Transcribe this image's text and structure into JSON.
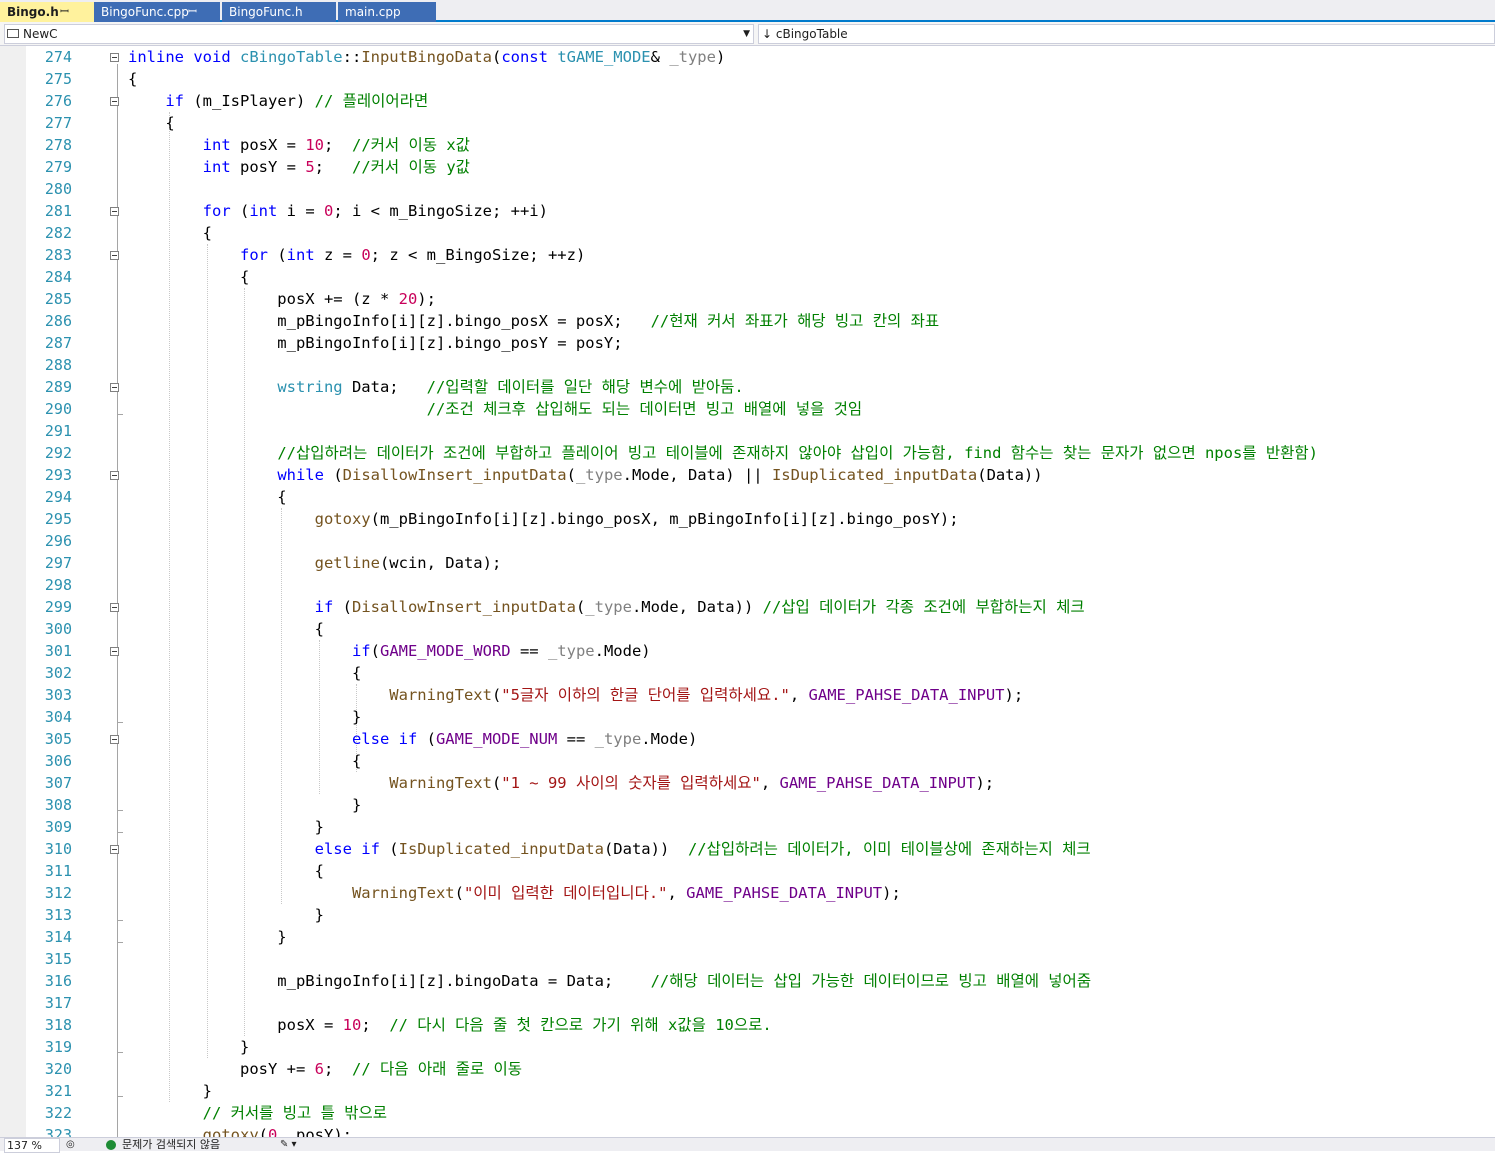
{
  "tabs": [
    {
      "label": "Bingo.h",
      "active": true,
      "pinned": true
    },
    {
      "label": "BingoFunc.cpp",
      "active": false,
      "pinned": true
    },
    {
      "label": "BingoFunc.h",
      "active": false,
      "pinned": false
    },
    {
      "label": "main.cpp",
      "active": false,
      "pinned": false
    }
  ],
  "nav": {
    "scope": "NewC",
    "member": "cBingoTable"
  },
  "status": {
    "zoom": "137 %",
    "issues": "문제가 검색되지 않음"
  },
  "lines": [
    {
      "n": "274",
      "segs": [
        [
          "kw",
          "inline void "
        ],
        [
          "ty",
          "cBingoTable"
        ],
        [
          "",
          "::"
        ],
        [
          "fn",
          "InputBingoData"
        ],
        [
          "",
          "("
        ],
        [
          "kw",
          "const "
        ],
        [
          "ty",
          "tGAME_MODE"
        ],
        [
          "",
          "& "
        ],
        [
          "pa",
          "_type"
        ],
        [
          "",
          ")"
        ]
      ]
    },
    {
      "n": "275",
      "segs": [
        [
          "",
          "{"
        ]
      ]
    },
    {
      "n": "276",
      "segs": [
        [
          "",
          "    "
        ],
        [
          "kw",
          "if"
        ],
        [
          "",
          " (m_IsPlayer) "
        ],
        [
          "cm",
          "// 플레이어라면"
        ]
      ]
    },
    {
      "n": "277",
      "segs": [
        [
          "",
          "    {"
        ]
      ]
    },
    {
      "n": "278",
      "segs": [
        [
          "",
          "        "
        ],
        [
          "kw",
          "int"
        ],
        [
          "",
          " posX = "
        ],
        [
          "num",
          "10"
        ],
        [
          "",
          ";  "
        ],
        [
          "cm",
          "//커서 이동 x값"
        ]
      ]
    },
    {
      "n": "279",
      "segs": [
        [
          "",
          "        "
        ],
        [
          "kw",
          "int"
        ],
        [
          "",
          " posY = "
        ],
        [
          "num",
          "5"
        ],
        [
          "",
          ";   "
        ],
        [
          "cm",
          "//커서 이동 y값"
        ]
      ]
    },
    {
      "n": "280",
      "segs": [
        [
          "",
          ""
        ]
      ]
    },
    {
      "n": "281",
      "segs": [
        [
          "",
          "        "
        ],
        [
          "kw",
          "for"
        ],
        [
          "",
          " ("
        ],
        [
          "kw",
          "int"
        ],
        [
          "",
          " i = "
        ],
        [
          "num",
          "0"
        ],
        [
          "",
          "; i < m_BingoSize; ++i)"
        ]
      ]
    },
    {
      "n": "282",
      "segs": [
        [
          "",
          "        {"
        ]
      ]
    },
    {
      "n": "283",
      "segs": [
        [
          "",
          "            "
        ],
        [
          "kw",
          "for"
        ],
        [
          "",
          " ("
        ],
        [
          "kw",
          "int"
        ],
        [
          "",
          " z = "
        ],
        [
          "num",
          "0"
        ],
        [
          "",
          "; z < m_BingoSize; ++z)"
        ]
      ]
    },
    {
      "n": "284",
      "segs": [
        [
          "",
          "            {"
        ]
      ]
    },
    {
      "n": "285",
      "segs": [
        [
          "",
          "                posX += (z * "
        ],
        [
          "num",
          "20"
        ],
        [
          "",
          ");"
        ]
      ]
    },
    {
      "n": "286",
      "segs": [
        [
          "",
          "                m_pBingoInfo[i][z].bingo_posX = posX;   "
        ],
        [
          "cm",
          "//현재 커서 좌표가 해당 빙고 칸의 좌표"
        ]
      ]
    },
    {
      "n": "287",
      "segs": [
        [
          "",
          "                m_pBingoInfo[i][z].bingo_posY = posY;"
        ]
      ]
    },
    {
      "n": "288",
      "segs": [
        [
          "",
          ""
        ]
      ]
    },
    {
      "n": "289",
      "segs": [
        [
          "",
          "                "
        ],
        [
          "ty",
          "wstring"
        ],
        [
          "",
          " Data;   "
        ],
        [
          "cm",
          "//입력할 데이터를 일단 해당 변수에 받아둠."
        ]
      ]
    },
    {
      "n": "290",
      "segs": [
        [
          "",
          "                                "
        ],
        [
          "cm",
          "//조건 체크후 삽입해도 되는 데이터면 빙고 배열에 넣을 것임"
        ]
      ]
    },
    {
      "n": "291",
      "segs": [
        [
          "",
          ""
        ]
      ]
    },
    {
      "n": "292",
      "segs": [
        [
          "",
          "                "
        ],
        [
          "cm",
          "//삽입하려는 데이터가 조건에 부합하고 플레이어 빙고 테이블에 존재하지 않아야 삽입이 가능함, find 함수는 찾는 문자가 없으면 npos를 반환함)"
        ]
      ]
    },
    {
      "n": "293",
      "segs": [
        [
          "",
          "                "
        ],
        [
          "kw",
          "while"
        ],
        [
          "",
          " ("
        ],
        [
          "fn",
          "DisallowInsert_inputData"
        ],
        [
          "",
          "("
        ],
        [
          "pa",
          "_type"
        ],
        [
          "",
          ".Mode, Data) || "
        ],
        [
          "fn",
          "IsDuplicated_inputData"
        ],
        [
          "",
          "(Data))"
        ]
      ]
    },
    {
      "n": "294",
      "segs": [
        [
          "",
          "                {"
        ]
      ]
    },
    {
      "n": "295",
      "segs": [
        [
          "",
          "                    "
        ],
        [
          "fn",
          "gotoxy"
        ],
        [
          "",
          "(m_pBingoInfo[i][z].bingo_posX, m_pBingoInfo[i][z].bingo_posY);"
        ]
      ]
    },
    {
      "n": "296",
      "segs": [
        [
          "",
          ""
        ]
      ]
    },
    {
      "n": "297",
      "segs": [
        [
          "",
          "                    "
        ],
        [
          "fn",
          "getline"
        ],
        [
          "",
          "(wcin, Data);"
        ]
      ]
    },
    {
      "n": "298",
      "segs": [
        [
          "",
          ""
        ]
      ]
    },
    {
      "n": "299",
      "segs": [
        [
          "",
          "                    "
        ],
        [
          "kw",
          "if"
        ],
        [
          "",
          " ("
        ],
        [
          "fn",
          "DisallowInsert_inputData"
        ],
        [
          "",
          "("
        ],
        [
          "pa",
          "_type"
        ],
        [
          "",
          ".Mode, Data)) "
        ],
        [
          "cm",
          "//삽입 데이터가 각종 조건에 부합하는지 체크"
        ]
      ]
    },
    {
      "n": "300",
      "segs": [
        [
          "",
          "                    {"
        ]
      ]
    },
    {
      "n": "301",
      "segs": [
        [
          "",
          "                        "
        ],
        [
          "kw",
          "if"
        ],
        [
          "",
          "("
        ],
        [
          "mc",
          "GAME_MODE_WORD"
        ],
        [
          "",
          " == "
        ],
        [
          "pa",
          "_type"
        ],
        [
          "",
          ".Mode)"
        ]
      ]
    },
    {
      "n": "302",
      "segs": [
        [
          "",
          "                        {"
        ]
      ]
    },
    {
      "n": "303",
      "segs": [
        [
          "",
          "                            "
        ],
        [
          "fn",
          "WarningText"
        ],
        [
          "",
          "("
        ],
        [
          "st",
          "\"5글자 이하의 한글 단어를 입력하세요.\""
        ],
        [
          "",
          ", "
        ],
        [
          "mc",
          "GAME_PAHSE_DATA_INPUT"
        ],
        [
          "",
          ");"
        ]
      ]
    },
    {
      "n": "304",
      "segs": [
        [
          "",
          "                        }"
        ]
      ]
    },
    {
      "n": "305",
      "segs": [
        [
          "",
          "                        "
        ],
        [
          "kw",
          "else if"
        ],
        [
          "",
          " ("
        ],
        [
          "mc",
          "GAME_MODE_NUM"
        ],
        [
          "",
          " == "
        ],
        [
          "pa",
          "_type"
        ],
        [
          "",
          ".Mode)"
        ]
      ]
    },
    {
      "n": "306",
      "segs": [
        [
          "",
          "                        {"
        ]
      ]
    },
    {
      "n": "307",
      "segs": [
        [
          "",
          "                            "
        ],
        [
          "fn",
          "WarningText"
        ],
        [
          "",
          "("
        ],
        [
          "st",
          "\"1 ~ 99 사이의 숫자를 입력하세요\""
        ],
        [
          "",
          ", "
        ],
        [
          "mc",
          "GAME_PAHSE_DATA_INPUT"
        ],
        [
          "",
          ");"
        ]
      ]
    },
    {
      "n": "308",
      "segs": [
        [
          "",
          "                        }"
        ]
      ]
    },
    {
      "n": "309",
      "segs": [
        [
          "",
          "                    }"
        ]
      ]
    },
    {
      "n": "310",
      "segs": [
        [
          "",
          "                    "
        ],
        [
          "kw",
          "else if"
        ],
        [
          "",
          " ("
        ],
        [
          "fn",
          "IsDuplicated_inputData"
        ],
        [
          "",
          "(Data))  "
        ],
        [
          "cm",
          "//삽입하려는 데이터가, 이미 테이블상에 존재하는지 체크"
        ]
      ]
    },
    {
      "n": "311",
      "segs": [
        [
          "",
          "                    {"
        ]
      ]
    },
    {
      "n": "312",
      "segs": [
        [
          "",
          "                        "
        ],
        [
          "fn",
          "WarningText"
        ],
        [
          "",
          "("
        ],
        [
          "st",
          "\"이미 입력한 데이터입니다.\""
        ],
        [
          "",
          ", "
        ],
        [
          "mc",
          "GAME_PAHSE_DATA_INPUT"
        ],
        [
          "",
          ");"
        ]
      ]
    },
    {
      "n": "313",
      "segs": [
        [
          "",
          "                    }"
        ]
      ]
    },
    {
      "n": "314",
      "segs": [
        [
          "",
          "                }"
        ]
      ]
    },
    {
      "n": "315",
      "segs": [
        [
          "",
          ""
        ]
      ]
    },
    {
      "n": "316",
      "segs": [
        [
          "",
          "                m_pBingoInfo[i][z].bingoData = Data;    "
        ],
        [
          "cm",
          "//해당 데이터는 삽입 가능한 데이터이므로 빙고 배열에 넣어줌"
        ]
      ]
    },
    {
      "n": "317",
      "segs": [
        [
          "",
          ""
        ]
      ]
    },
    {
      "n": "318",
      "segs": [
        [
          "",
          "                posX = "
        ],
        [
          "num",
          "10"
        ],
        [
          "",
          ";  "
        ],
        [
          "cm",
          "// 다시 다음 줄 첫 칸으로 가기 위해 x값을 10으로."
        ]
      ]
    },
    {
      "n": "319",
      "segs": [
        [
          "",
          "            }"
        ]
      ]
    },
    {
      "n": "320",
      "segs": [
        [
          "",
          "            posY += "
        ],
        [
          "num",
          "6"
        ],
        [
          "",
          ";  "
        ],
        [
          "cm",
          "// 다음 아래 줄로 이동"
        ]
      ]
    },
    {
      "n": "321",
      "segs": [
        [
          "",
          "        }"
        ]
      ]
    },
    {
      "n": "322",
      "segs": [
        [
          "",
          "        "
        ],
        [
          "cm",
          "// 커서를 빙고 틀 밖으로"
        ]
      ]
    },
    {
      "n": "323",
      "segs": [
        [
          "",
          "        "
        ],
        [
          "fn",
          "gotoxy"
        ],
        [
          "",
          "("
        ],
        [
          "num",
          "0"
        ],
        [
          "",
          ", posY);"
        ]
      ]
    }
  ]
}
